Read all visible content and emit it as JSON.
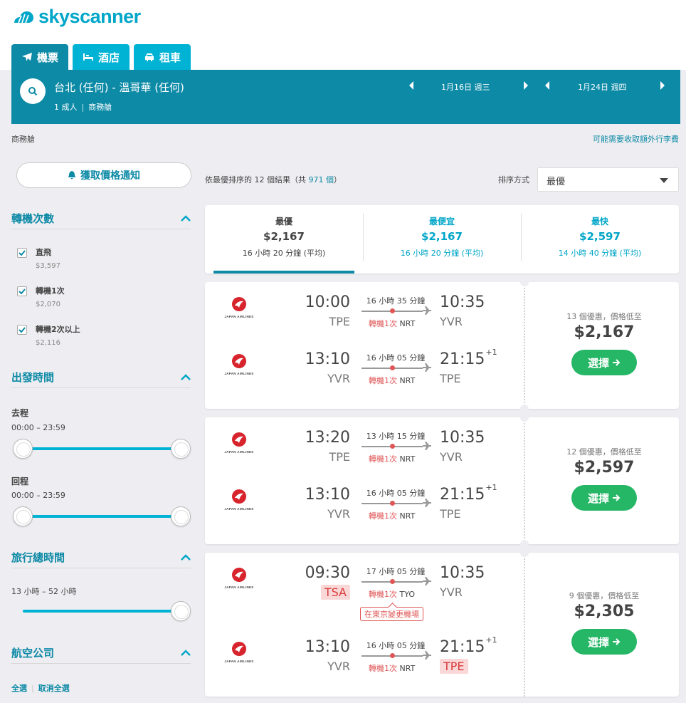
{
  "brand": {
    "name": "skyscanner",
    "accent": "#00a6c8",
    "dark_accent": "#0c8aa6",
    "cta_color": "#26b766"
  },
  "tabs": [
    {
      "label": "機票",
      "icon": "plane-icon",
      "active": true
    },
    {
      "label": "酒店",
      "icon": "bed-icon",
      "active": false
    },
    {
      "label": "租車",
      "icon": "car-icon",
      "active": false
    }
  ],
  "search": {
    "route": "台北 (任何) - 溫哥華 (任何)",
    "passengers": "1 成人",
    "cabin": "商務艙",
    "depart_date": "1月16日 週三",
    "return_date": "1月24日 週四"
  },
  "cabin_note": "商務艙",
  "baggage_note": "可能需要收取額外行李費",
  "sidebar": {
    "price_alert": "獲取價格通知",
    "stops": {
      "title": "轉機次數",
      "options": [
        {
          "label": "直飛",
          "price": "$3,597",
          "checked": true
        },
        {
          "label": "轉機1次",
          "price": "$2,070",
          "checked": true
        },
        {
          "label": "轉機2次以上",
          "price": "$2,116",
          "checked": true
        }
      ]
    },
    "departure_times": {
      "title": "出發時間",
      "outbound_label": "去程",
      "outbound_range": "00:00 – 23:59",
      "inbound_label": "回程",
      "inbound_range": "00:00 – 23:59"
    },
    "duration": {
      "title": "旅行總時間",
      "range": "13 小時 – 52 小時"
    },
    "airlines": {
      "title": "航空公司",
      "select_all": "全選",
      "clear_all": "取消全選"
    }
  },
  "results": {
    "count_prefix": "依最優排序的 12 個結果（共",
    "count_total": "971 個",
    "count_suffix": "）",
    "sort_label": "排序方式",
    "sort_value": "最優"
  },
  "sort_tabs": [
    {
      "label": "最優",
      "price": "$2,167",
      "duration": "16 小時 20 分鐘 (平均)",
      "active": true
    },
    {
      "label": "最便宜",
      "price": "$2,167",
      "duration": "16 小時 20 分鐘 (平均)",
      "active": false
    },
    {
      "label": "最快",
      "price": "$2,597",
      "duration": "14 小時 40 分鐘 (平均)",
      "active": false
    }
  ],
  "airline_logo_text": "JAPAN AIRLINES",
  "flights": [
    {
      "offers": "13 個優惠，價格低至",
      "price": "$2,167",
      "select_label": "選擇",
      "legs": [
        {
          "dep_time": "10:00",
          "dep_airport": "TPE",
          "arr_time": "10:35",
          "arr_airport": "YVR",
          "duration": "16 小時 35 分鐘",
          "stop_label": "轉機1次",
          "stop_airport": "NRT"
        },
        {
          "dep_time": "13:10",
          "dep_airport": "YVR",
          "arr_time": "21:15",
          "arr_plus": "+1",
          "arr_airport": "TPE",
          "duration": "16 小時 05 分鐘",
          "stop_label": "轉機1次",
          "stop_airport": "NRT"
        }
      ]
    },
    {
      "offers": "12 個優惠，價格低至",
      "price": "$2,597",
      "select_label": "選擇",
      "legs": [
        {
          "dep_time": "13:20",
          "dep_airport": "TPE",
          "arr_time": "10:35",
          "arr_airport": "YVR",
          "duration": "13 小時 15 分鐘",
          "stop_label": "轉機1次",
          "stop_airport": "NRT"
        },
        {
          "dep_time": "13:10",
          "dep_airport": "YVR",
          "arr_time": "21:15",
          "arr_plus": "+1",
          "arr_airport": "TPE",
          "duration": "16 小時 05 分鐘",
          "stop_label": "轉機1次",
          "stop_airport": "NRT"
        }
      ]
    },
    {
      "offers": "9 個優惠，價格低至",
      "price": "$2,305",
      "select_label": "選擇",
      "legs": [
        {
          "dep_time": "09:30",
          "dep_airport": "TSA",
          "arr_time": "10:35",
          "arr_airport": "YVR",
          "duration": "17 小時 05 分鐘",
          "stop_label": "轉機1次",
          "stop_airport": "TYO",
          "airport_change": "在東京變更機場"
        },
        {
          "dep_time": "13:10",
          "dep_airport": "YVR",
          "arr_time": "21:15",
          "arr_plus": "+1",
          "arr_airport": "TPE",
          "duration": "16 小時 05 分鐘",
          "stop_label": "轉機1次",
          "stop_airport": "NRT"
        }
      ]
    }
  ]
}
